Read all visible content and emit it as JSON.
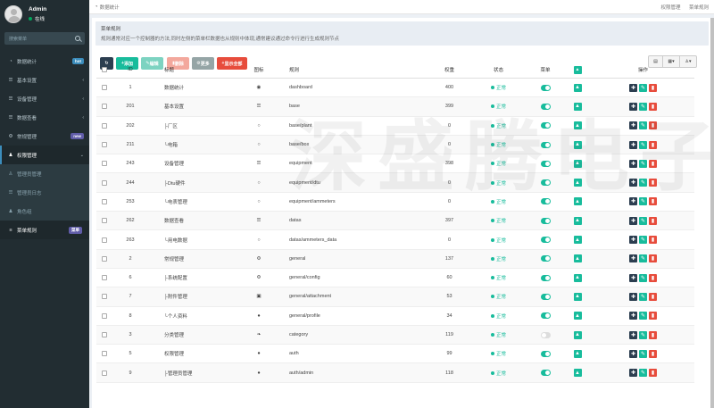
{
  "user": {
    "name": "Admin",
    "status": "在线"
  },
  "search": {
    "placeholder": "搜索菜单"
  },
  "sidebar": {
    "items": [
      {
        "label": "数据统计",
        "icon": "dashboard-icon",
        "badge": "hot",
        "badge_color": "#3c8dbc"
      },
      {
        "label": "基本设置",
        "icon": "list-icon",
        "chevron": "‹"
      },
      {
        "label": "设备管理",
        "icon": "list-icon",
        "chevron": "‹"
      },
      {
        "label": "数据查看",
        "icon": "list-icon",
        "chevron": "‹"
      },
      {
        "label": "常规管理",
        "icon": "gear-icon",
        "badge": "new",
        "badge_color": "#605ca8"
      },
      {
        "label": "权限管理",
        "icon": "group-icon",
        "chevron": "⌄"
      }
    ],
    "subitems": [
      {
        "label": "管理员管理",
        "icon": "user-icon"
      },
      {
        "label": "管理员日志",
        "icon": "list-icon"
      },
      {
        "label": "角色组",
        "icon": "group-icon"
      },
      {
        "label": "菜单规则",
        "icon": "bars-icon",
        "badge": "菜单",
        "badge_color": "#605ca8"
      }
    ]
  },
  "topbar": {
    "breadcrumb": "数据统计",
    "links": [
      "权限管理",
      "菜单规则"
    ]
  },
  "intro": {
    "title": "菜单规则",
    "desc": "规则通常对应一个控制器的方法,同时左侧的菜单栏数据也从规则中体现,通常建议通过命令行进行生成规则节点"
  },
  "toolbar": {
    "add": "添加",
    "edit": "编辑",
    "delete": "删除",
    "more": "更多",
    "toggle_all": "显示全部"
  },
  "watermark": "深盛腾电子科技",
  "table": {
    "headers": {
      "id": "ID",
      "title": "标题",
      "icon": "图标",
      "rule": "规则",
      "weight": "权重",
      "status": "状态",
      "menu": "菜单",
      "ops": "操作"
    },
    "rows": [
      {
        "id": "1",
        "title": "数据统计",
        "icon": "◉",
        "rule": "dashboard",
        "weight": "400",
        "status": "正常",
        "menu": true
      },
      {
        "id": "201",
        "title": "基本设置",
        "icon": "☰",
        "rule": "base",
        "weight": "399",
        "status": "正常",
        "menu": true
      },
      {
        "id": "202",
        "title": "├厂区",
        "icon": "○",
        "rule": "base/plant",
        "weight": "0",
        "status": "正常",
        "menu": true
      },
      {
        "id": "211",
        "title": "└电箱",
        "icon": "○",
        "rule": "base/box",
        "weight": "0",
        "status": "正常",
        "menu": true
      },
      {
        "id": "243",
        "title": "设备管理",
        "icon": "☰",
        "rule": "equipment",
        "weight": "398",
        "status": "正常",
        "menu": true
      },
      {
        "id": "244",
        "title": "├Dtu硬件",
        "icon": "○",
        "rule": "equipment/dtu",
        "weight": "0",
        "status": "正常",
        "menu": true
      },
      {
        "id": "253",
        "title": "└电表管理",
        "icon": "○",
        "rule": "equipment/ammeters",
        "weight": "0",
        "status": "正常",
        "menu": true
      },
      {
        "id": "262",
        "title": "数据查看",
        "icon": "☰",
        "rule": "datas",
        "weight": "397",
        "status": "正常",
        "menu": true
      },
      {
        "id": "263",
        "title": "└用电数据",
        "icon": "○",
        "rule": "datas/ammeters_data",
        "weight": "0",
        "status": "正常",
        "menu": true
      },
      {
        "id": "2",
        "title": "常规管理",
        "icon": "⚙",
        "rule": "general",
        "weight": "137",
        "status": "正常",
        "menu": true
      },
      {
        "id": "6",
        "title": "├系统配置",
        "icon": "⚙",
        "rule": "general/config",
        "weight": "60",
        "status": "正常",
        "menu": true
      },
      {
        "id": "7",
        "title": "├附件管理",
        "icon": "▣",
        "rule": "general/attachment",
        "weight": "53",
        "status": "正常",
        "menu": true
      },
      {
        "id": "8",
        "title": "└个人资料",
        "icon": "●",
        "rule": "general/profile",
        "weight": "34",
        "status": "正常",
        "menu": true
      },
      {
        "id": "3",
        "title": "分类管理",
        "icon": "❧",
        "rule": "category",
        "weight": "119",
        "status": "正常",
        "menu": false
      },
      {
        "id": "5",
        "title": "权限管理",
        "icon": "●",
        "rule": "auth",
        "weight": "99",
        "status": "正常",
        "menu": true
      },
      {
        "id": "9",
        "title": "├管理员管理",
        "icon": "●",
        "rule": "auth/admin",
        "weight": "118",
        "status": "正常",
        "menu": true
      }
    ]
  }
}
